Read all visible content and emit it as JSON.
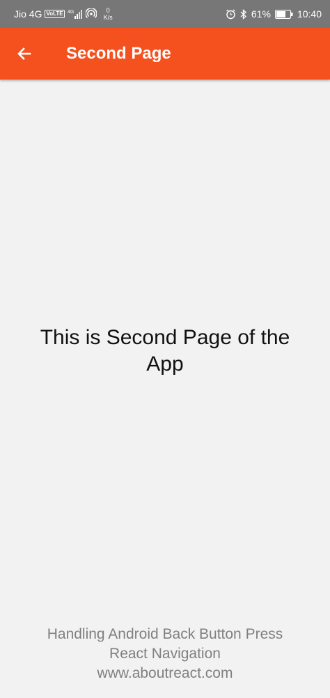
{
  "status_bar": {
    "carrier": "Jio 4G",
    "volte": "VoLTE",
    "network_type": "4G",
    "net_speed_value": "0",
    "net_speed_unit": "K/s",
    "battery_percent": "61%",
    "time": "10:40",
    "icons": [
      "signal-icon",
      "hotspot-icon",
      "alarm-icon",
      "bluetooth-icon",
      "battery-icon"
    ]
  },
  "app_bar": {
    "title": "Second Page",
    "back_icon": "back-arrow-icon",
    "color": "#f4511e"
  },
  "main": {
    "text": "This is Second Page of the App"
  },
  "footer": {
    "line1": "Handling Android Back Button Press",
    "line2": "React Navigation",
    "line3": "www.aboutreact.com"
  }
}
